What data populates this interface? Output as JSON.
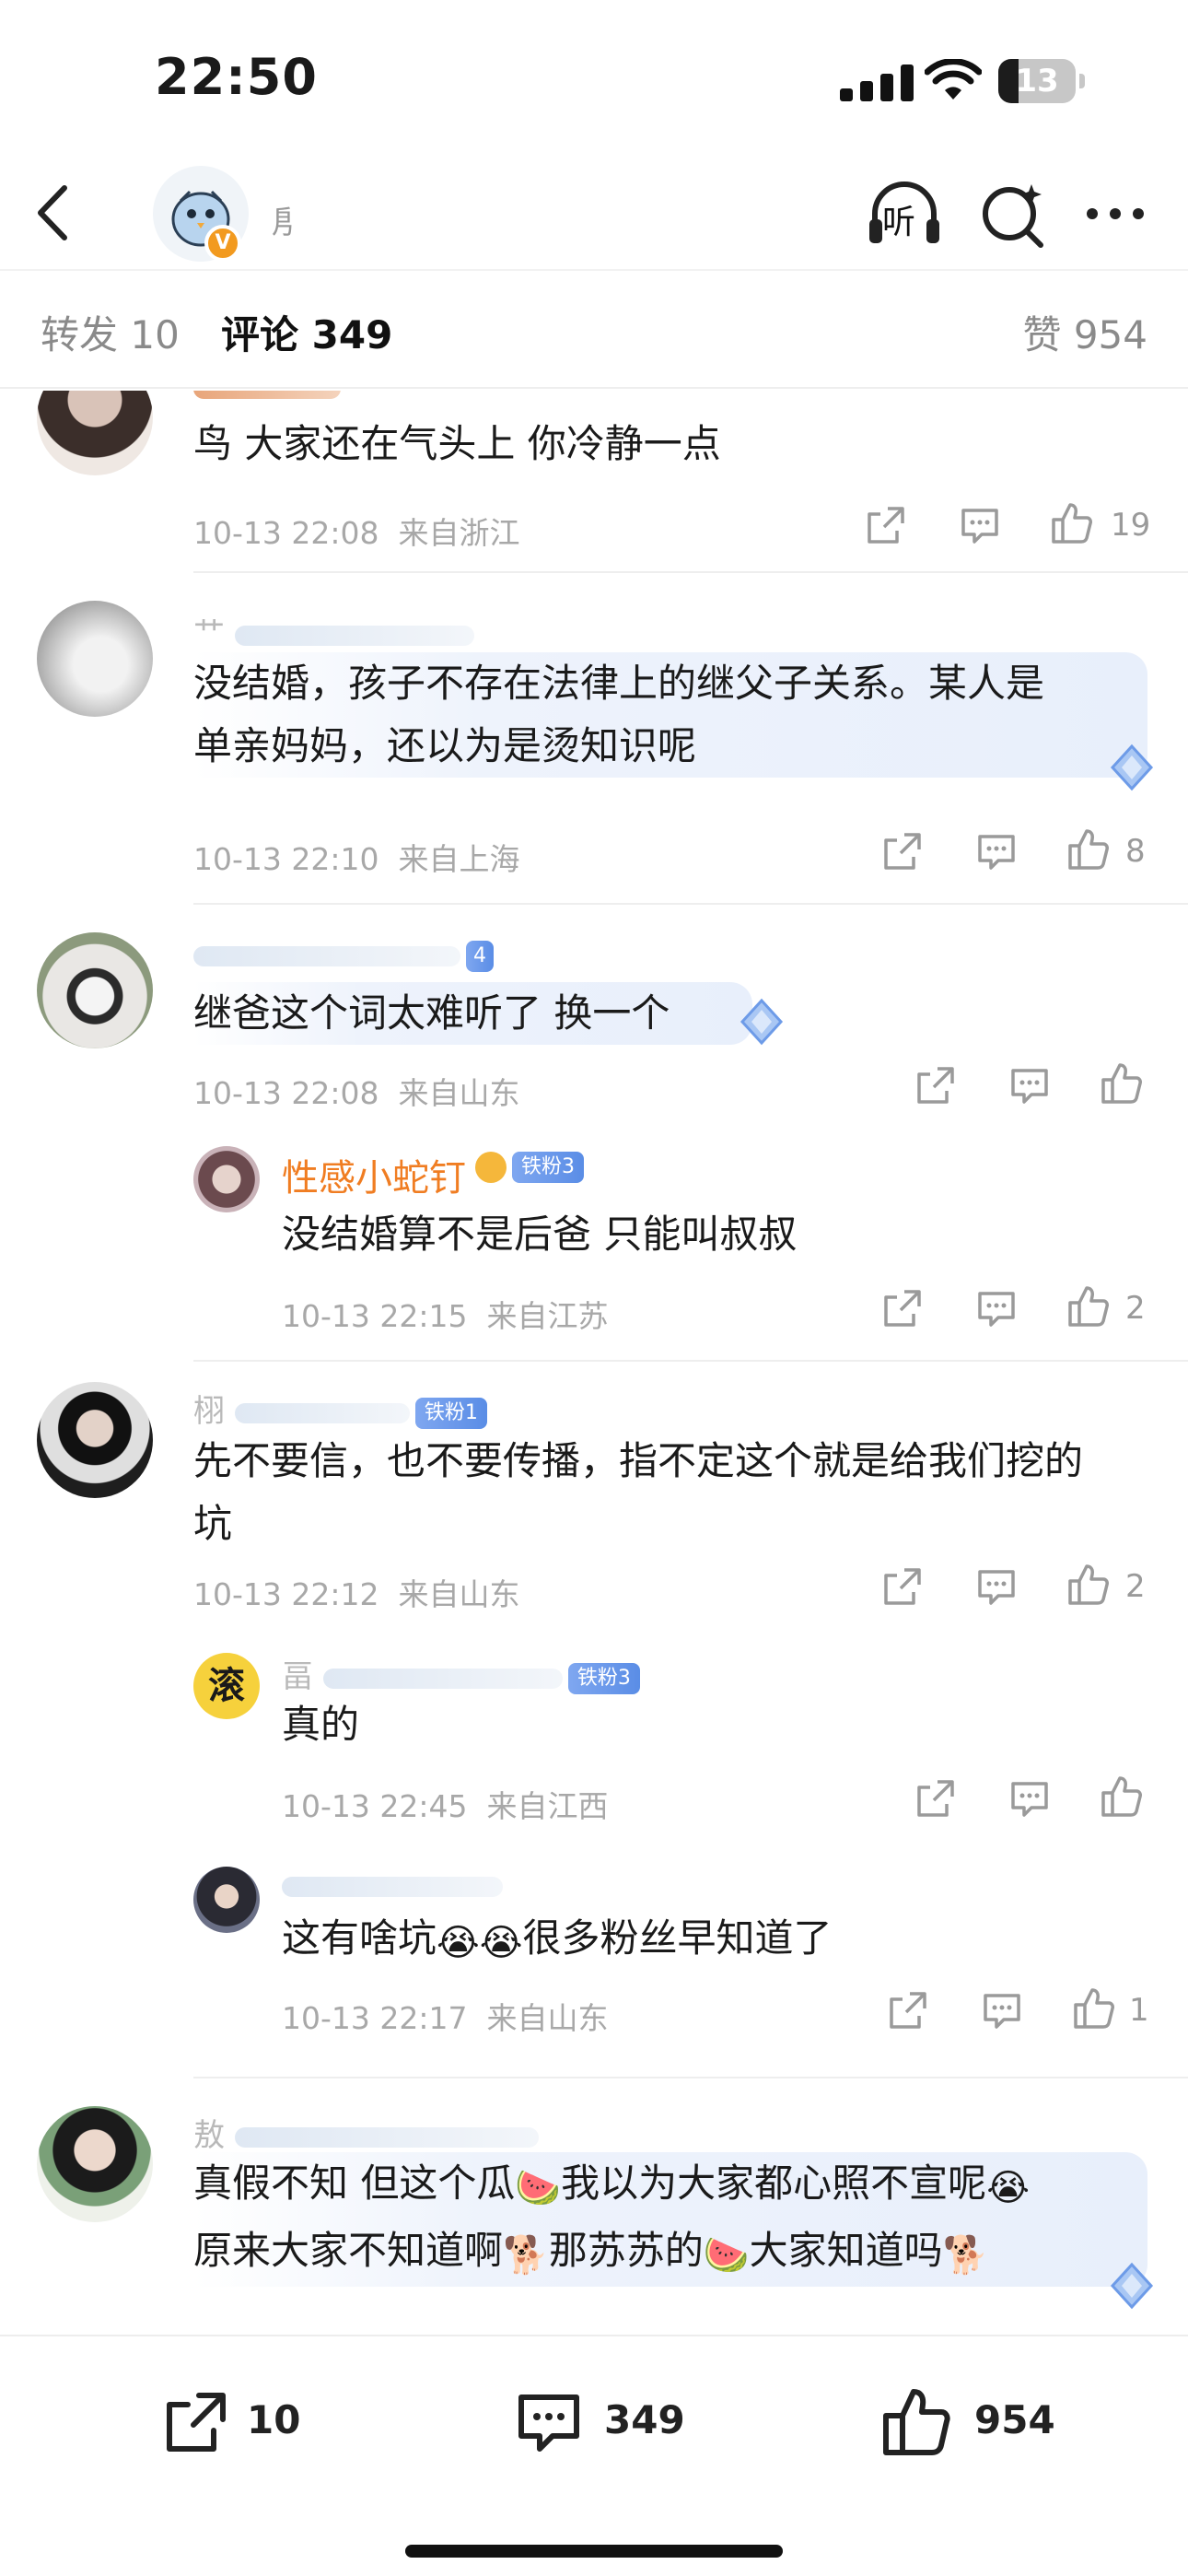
{
  "status": {
    "time": "22:50",
    "battery": "13"
  },
  "nav": {
    "listen_label": "听",
    "verified_badge": "V",
    "user_name_partial": "㐆"
  },
  "tabs": {
    "repost": "转发 10",
    "comments": "评论 349",
    "likes": "赞 954"
  },
  "comments": [
    {
      "text": "鸟 大家还在气头上 你冷静一点",
      "time": "10-13 22:08",
      "location": "来自浙江",
      "likes": "19"
    },
    {
      "name_partial": "艹",
      "text_line1": "没结婚，孩子不存在法律上的继父子关系。某人是",
      "text_line2": "单亲妈妈，还以为是烫知识呢",
      "time": "10-13 22:10",
      "location": "来自上海",
      "likes": "8"
    },
    {
      "badge": "4",
      "text": "继爸这个词太难听了 换一个",
      "time": "10-13 22:08",
      "location": "来自山东",
      "likes": ""
    }
  ],
  "reply1": {
    "name": "性感小蛇钉",
    "badge": "铁粉3",
    "text": "没结婚算不是后爸 只能叫叔叔",
    "time": "10-13 22:15",
    "location": "来自江苏",
    "likes": "2"
  },
  "comment4": {
    "name_partial": "栩",
    "badge": "铁粉1",
    "text_line1": "先不要信，也不要传播，指不定这个就是给我们挖的",
    "text_line2": "坑",
    "time": "10-13 22:12",
    "location": "来自山东",
    "likes": "2"
  },
  "reply2": {
    "avatar_text": "滚",
    "name_partial": "畐",
    "badge": "铁粉3",
    "text": "真的",
    "time": "10-13 22:45",
    "location": "来自江西",
    "likes": ""
  },
  "reply3": {
    "text_a": "这有啥坑",
    "text_b": "很多粉丝早知道了",
    "emoji_cry": "😭",
    "time": "10-13 22:17",
    "location": "来自山东",
    "likes": "1"
  },
  "comment5": {
    "name_partial": "敖",
    "line1_a": "真假不知 但这个瓜",
    "line1_b": "我以为大家都心照不宣呢",
    "line2_a": "原来大家不知道啊",
    "line2_b": "那苏苏的",
    "line2_c": "大家知道吗",
    "emoji_melon": "🍉",
    "emoji_cry": "😭",
    "emoji_dog": "🐕"
  },
  "bottom": {
    "reposts": "10",
    "comments": "349",
    "likes": "954"
  }
}
